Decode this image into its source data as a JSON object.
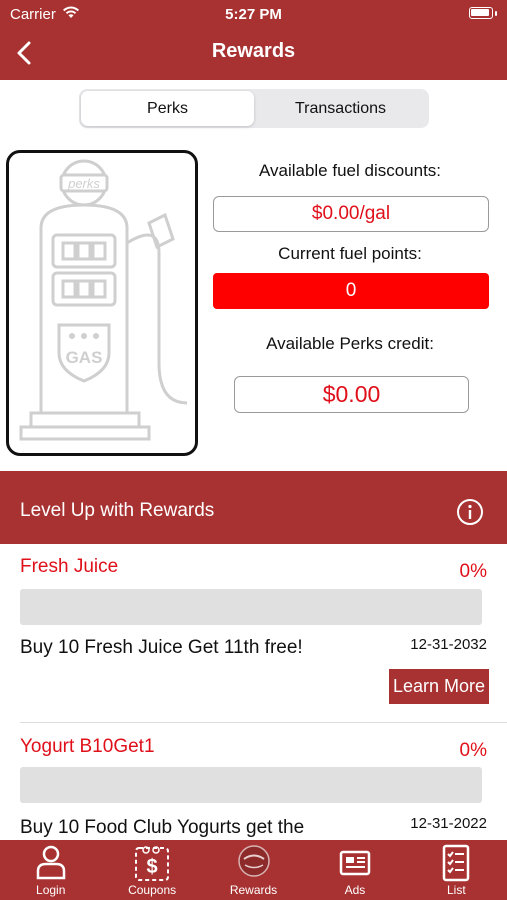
{
  "status_bar": {
    "carrier": "Carrier",
    "time": "5:27 PM"
  },
  "nav": {
    "title": "Rewards",
    "back_icon": "chevron-left-icon"
  },
  "segments": {
    "perks": "Perks",
    "transactions": "Transactions",
    "selected": "Perks"
  },
  "pump_image": {
    "sign_text": "perks",
    "badge_text": "GAS"
  },
  "fuel": {
    "discounts_label": "Available fuel discounts:",
    "discounts_value": "$0.00/gal",
    "points_label": "Current fuel points:",
    "points_value": "0",
    "credit_label": "Available Perks credit:",
    "credit_value": "$0.00"
  },
  "banner": {
    "title": "Level Up with Rewards",
    "info_icon": "info-icon"
  },
  "rewards": [
    {
      "name": "Fresh Juice",
      "percent": "0%",
      "progress": 0,
      "description": "Buy 10 Fresh Juice Get 11th free!",
      "date": "12-31-2032",
      "button": "Learn More"
    },
    {
      "name": "Yogurt B10Get1",
      "percent": "0%",
      "progress": 0,
      "description": "Buy 10 Food Club Yogurts get the",
      "date": "12-31-2022"
    }
  ],
  "tabbar": {
    "items": [
      {
        "label": "Login",
        "icon": "person-icon"
      },
      {
        "label": "Coupons",
        "icon": "coupon-scissors-icon"
      },
      {
        "label": "Rewards",
        "icon": "rewards-logo-icon"
      },
      {
        "label": "Ads",
        "icon": "ads-icon"
      },
      {
        "label": "List",
        "icon": "list-icon"
      }
    ]
  },
  "colors": {
    "brand": "#a83232",
    "accent_red": "#e0101a",
    "points_bg": "#ff0000"
  }
}
